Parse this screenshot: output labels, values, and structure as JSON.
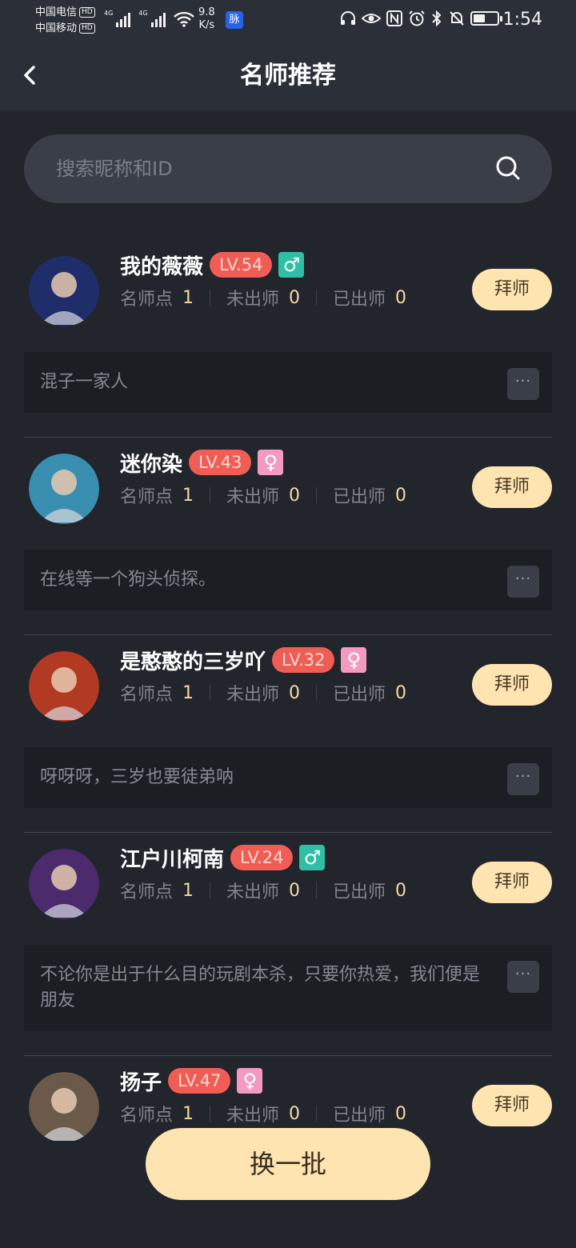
{
  "status_bar": {
    "carrier_1": "中国电信",
    "carrier_2": "中国移动",
    "hd_badge": "HD",
    "net_1": "4G",
    "net_2": "4G",
    "speed_value": "9.8",
    "speed_unit": "K/s",
    "app_badge": "脉",
    "time": "1:54",
    "icons": [
      "headset-icon",
      "eye-icon",
      "nfc-icon",
      "alarm-icon",
      "bluetooth-icon",
      "mute-icon",
      "battery-icon"
    ],
    "battery_level": 0.5
  },
  "header": {
    "title": "名师推荐",
    "back_icon": "chevron-left-icon"
  },
  "search": {
    "placeholder": "搜索昵称和ID",
    "value": "",
    "icon": "search-icon"
  },
  "labels": {
    "points": "名师点",
    "unfinished": "未出师",
    "finished": "已出师",
    "follow": "拜师",
    "more": "···"
  },
  "teachers": [
    {
      "name": "我的薇薇",
      "level": "LV.54",
      "gender": "male",
      "gender_symbol": "♂",
      "points": "1",
      "unfinished": "0",
      "finished": "0",
      "desc": "混子一家人",
      "avatar_color": "#1f2d6b"
    },
    {
      "name": "迷你染",
      "level": "LV.43",
      "gender": "female",
      "gender_symbol": "♀",
      "points": "1",
      "unfinished": "0",
      "finished": "0",
      "desc": "在线等一个狗头侦探。",
      "avatar_color": "#3a8fb0"
    },
    {
      "name": "是憨憨的三岁吖",
      "level": "LV.32",
      "gender": "female",
      "gender_symbol": "♀",
      "points": "1",
      "unfinished": "0",
      "finished": "0",
      "desc": "呀呀呀，三岁也要徒弟呐",
      "avatar_color": "#b23a22"
    },
    {
      "name": "江户川柯南",
      "level": "LV.24",
      "gender": "male",
      "gender_symbol": "♂",
      "points": "1",
      "unfinished": "0",
      "finished": "0",
      "desc": "不论你是出于什么目的玩剧本杀，只要你热爱，我们便是朋友",
      "avatar_color": "#4b2a6e"
    },
    {
      "name": "扬子",
      "level": "LV.47",
      "gender": "female",
      "gender_symbol": "♀",
      "points": "1",
      "unfinished": "0",
      "finished": "0",
      "desc": "",
      "avatar_color": "#6b5a4a"
    }
  ],
  "refresh_button": "换一批"
}
